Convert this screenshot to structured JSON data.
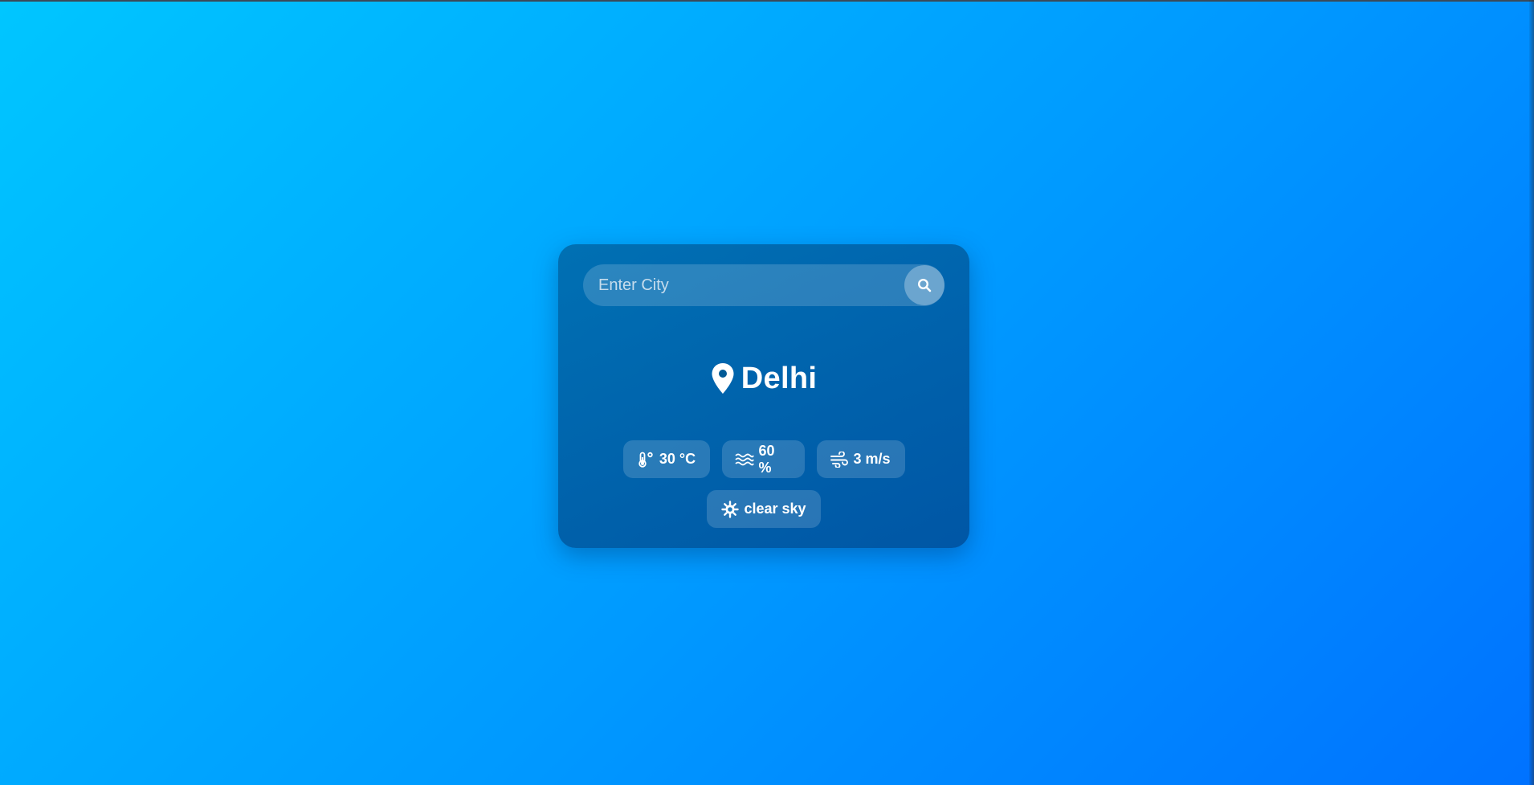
{
  "search": {
    "placeholder": "Enter City",
    "value": "",
    "button_icon": "search-icon"
  },
  "location": {
    "icon": "location-pin-icon",
    "city": "Delhi"
  },
  "stats": {
    "temperature": {
      "icon": "thermometer-icon",
      "value": "30 °C"
    },
    "humidity": {
      "icon": "water-waves-icon",
      "value": "60 %"
    },
    "wind": {
      "icon": "wind-icon",
      "value": "3 m/s"
    }
  },
  "condition": {
    "icon": "sun-icon",
    "description": "clear sky"
  },
  "colors": {
    "background_start": "#00c6ff",
    "background_end": "#0072ff",
    "card": "#005a96",
    "text": "#ffffff"
  }
}
